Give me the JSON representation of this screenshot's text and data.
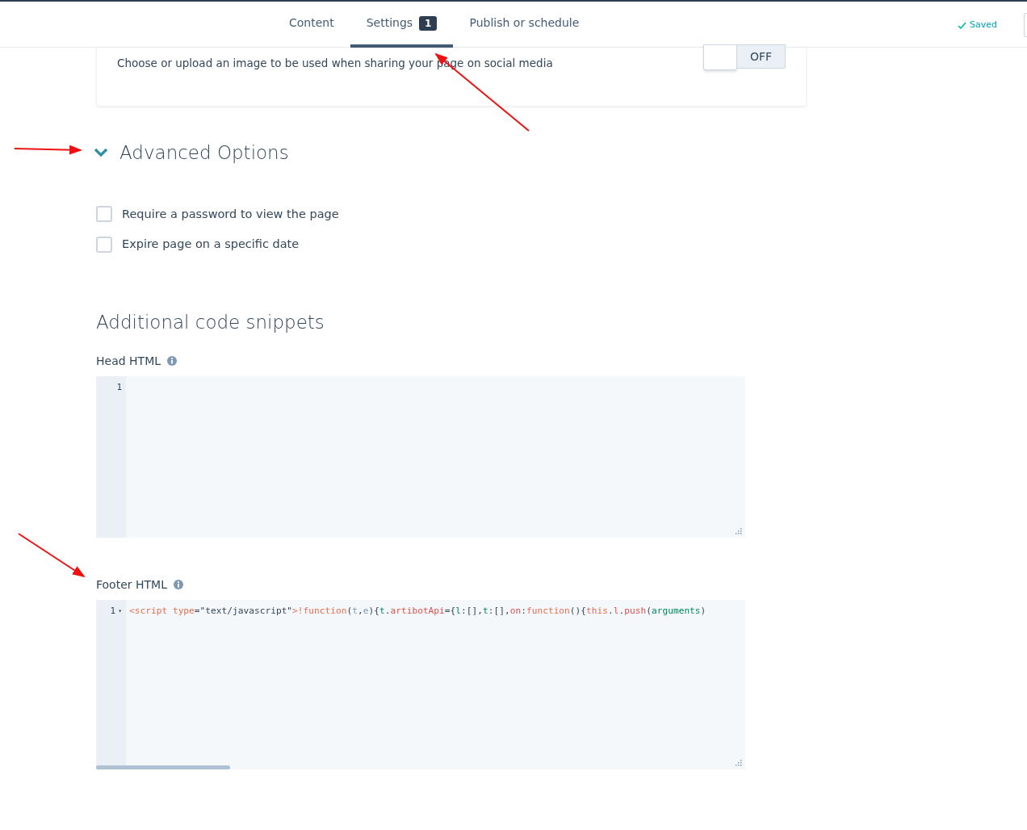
{
  "tabs": [
    {
      "label": "Content",
      "selected": false
    },
    {
      "label": "Settings",
      "selected": true,
      "badge": "1"
    },
    {
      "label": "Publish or schedule",
      "selected": false
    }
  ],
  "save_status": {
    "label": "Saved",
    "saved": true
  },
  "social_card": {
    "description": "Choose or upload an image to be used when sharing your page on social media",
    "toggle": {
      "on": false,
      "label": "OFF"
    }
  },
  "advanced_options": {
    "title": "Advanced Options",
    "expanded": true,
    "options": [
      {
        "label": "Require a password to view the page",
        "checked": false
      },
      {
        "label": "Expire page on a specific date",
        "checked": false
      }
    ]
  },
  "code_snippets": {
    "title": "Additional code snippets",
    "editors": [
      {
        "label": "Head HTML",
        "lines": [
          {
            "number": "1"
          }
        ]
      },
      {
        "label": "Footer HTML",
        "lines": [
          {
            "number": "1",
            "fold_marker": "▾",
            "tokens": [
              {
                "text": "<script",
                "kind": "tag"
              },
              {
                "text": " type",
                "kind": "attr"
              },
              {
                "text": "=",
                "kind": "plain"
              },
              {
                "text": "\"text/javascript\"",
                "kind": "string"
              },
              {
                "text": ">",
                "kind": "tag"
              },
              {
                "text": "!function",
                "kind": "keyword"
              },
              {
                "text": "(",
                "kind": "plain"
              },
              {
                "text": "t",
                "kind": "param"
              },
              {
                "text": ",",
                "kind": "plain"
              },
              {
                "text": "e",
                "kind": "param"
              },
              {
                "text": "){",
                "kind": "plain"
              },
              {
                "text": "t",
                "kind": "var"
              },
              {
                "text": ".",
                "kind": "plain"
              },
              {
                "text": "artibotApi",
                "kind": "prop"
              },
              {
                "text": "={",
                "kind": "plain"
              },
              {
                "text": "l",
                "kind": "var"
              },
              {
                "text": ":[],",
                "kind": "plain"
              },
              {
                "text": "t",
                "kind": "var"
              },
              {
                "text": ":[],",
                "kind": "plain"
              },
              {
                "text": "on",
                "kind": "prop"
              },
              {
                "text": ":",
                "kind": "plain"
              },
              {
                "text": "function",
                "kind": "keyword"
              },
              {
                "text": "(){",
                "kind": "plain"
              },
              {
                "text": "this",
                "kind": "keyword"
              },
              {
                "text": ".",
                "kind": "plain"
              },
              {
                "text": "l",
                "kind": "prop"
              },
              {
                "text": ".",
                "kind": "plain"
              },
              {
                "text": "push",
                "kind": "prop"
              },
              {
                "text": "(",
                "kind": "plain"
              },
              {
                "text": "arguments",
                "kind": "var"
              },
              {
                "text": ")",
                "kind": "plain"
              }
            ]
          }
        ]
      }
    ]
  }
}
